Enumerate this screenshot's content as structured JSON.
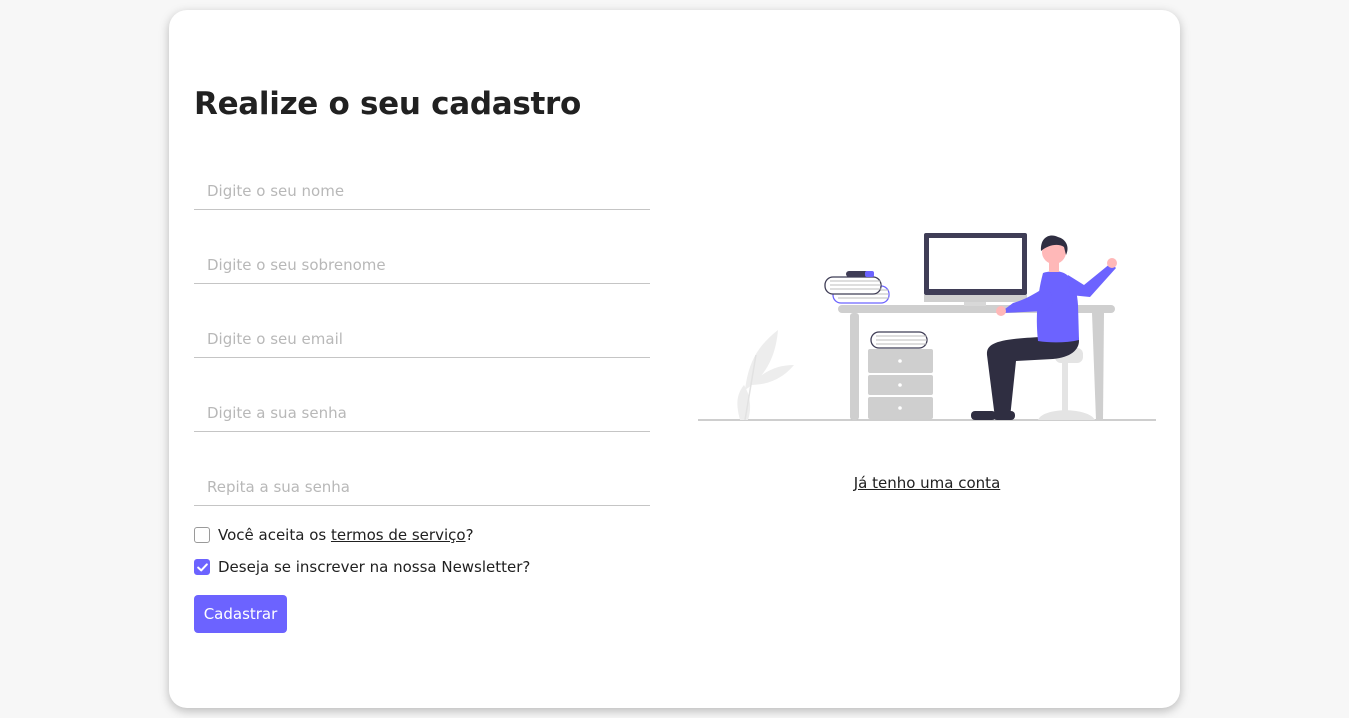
{
  "form": {
    "title": "Realize o seu cadastro",
    "fields": [
      {
        "placeholder": "Digite o seu nome",
        "value": ""
      },
      {
        "placeholder": "Digite o seu sobrenome",
        "value": ""
      },
      {
        "placeholder": "Digite o seu email",
        "value": ""
      },
      {
        "placeholder": "Digite a sua senha",
        "value": ""
      },
      {
        "placeholder": "Repita a sua senha",
        "value": ""
      }
    ],
    "terms": {
      "prefix": "Você aceita os ",
      "link": "termos de serviço",
      "suffix": "?",
      "checked": false
    },
    "newsletter": {
      "label": "Deseja se inscrever na nossa Newsletter?",
      "checked": true
    },
    "submit_label": "Cadastrar"
  },
  "side": {
    "illustration": "person-at-desk-illustration",
    "login_link": "Já tenho uma conta"
  },
  "colors": {
    "accent": "#6c63ff",
    "background": "#f7f7f7",
    "card": "#ffffff",
    "text": "#212121"
  }
}
